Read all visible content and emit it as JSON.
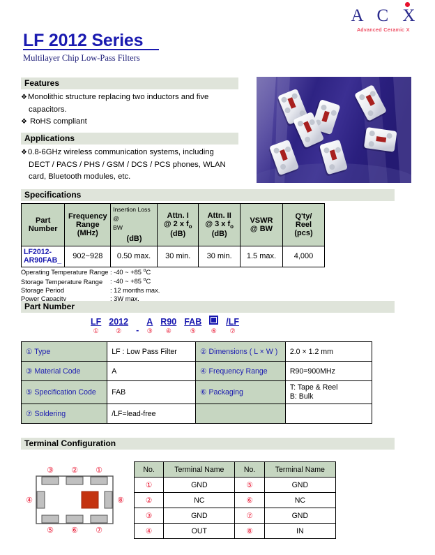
{
  "logo": {
    "letters": "A C X",
    "tagline": "Advanced Ceramic X",
    "dot_color": "#e8112d",
    "letter_color": "#2a2a8c"
  },
  "header": {
    "title": "LF 2012 Series",
    "subtitle": "Multilayer Chip Low-Pass Filters",
    "title_color": "#1a1ab0"
  },
  "features": {
    "heading": "Features",
    "items": [
      {
        "line1": "Monolithic structure replacing two inductors and five",
        "line2": "capacitors."
      },
      {
        "line1": " RoHS compliant",
        "line2": ""
      }
    ]
  },
  "applications": {
    "heading": "Applications",
    "items": [
      {
        "line1": "0.8-6GHz wireless communication systems, including",
        "line2": "DECT / PACS / PHS / GSM / DCS / PCS phones, WLAN",
        "line3": "card, Bluetooth modules, etc."
      }
    ]
  },
  "specifications": {
    "heading": "Specifications",
    "columns": [
      "Part Number",
      "Frequency Range (MHz)",
      "Insertion Loss @ BW (dB)",
      "Attn. I @ 2 x fo (dB)",
      "Attn. II @ 3 x fo (dB)",
      "VSWR @ BW",
      "Q'ty/ Reel (pcs)"
    ],
    "col_freq_l1": "Frequency",
    "col_freq_l2": "Range",
    "col_freq_l3": "(MHz)",
    "col_il_l1": "Insertion Loss @",
    "col_il_l2": "BW",
    "col_il_l3": "(dB)",
    "col_attn1_l1": "Attn. I",
    "col_attn1_l2": "@ 2 x f",
    "col_attn1_sub": "o",
    "col_attn1_l3": "(dB)",
    "col_attn2_l1": "Attn. II",
    "col_attn2_l2": "@ 3 x f",
    "col_attn2_sub": "o",
    "col_attn2_l3": "(dB)",
    "col_vswr_l1": "VSWR",
    "col_vswr_l2": "@ BW",
    "col_qty_l1": "Q'ty/",
    "col_qty_l2": "Reel",
    "col_qty_l3": "(pcs)",
    "col_partnumber": "Part Number",
    "rows": [
      {
        "part_number_l1": "LF2012-",
        "part_number_l2": "AR90FAB_",
        "frequency_range": "902~928",
        "insertion_loss": "0.50 max.",
        "attn_1": "30 min.",
        "attn_2": "30 min.",
        "vswr": "1.5 max.",
        "qty_reel": "4,000"
      }
    ]
  },
  "conditions": [
    {
      "label": "Operating Temperature Range",
      "value": ": -40 ~ +85 ",
      "unit": "o",
      "unit2": "C"
    },
    {
      "label": "Storage Temperature Range",
      "value": ": -40 ~ +85 ",
      "unit": "o",
      "unit2": "C"
    },
    {
      "label": "Storage Period",
      "value": ": 12 months max.",
      "unit": "",
      "unit2": ""
    },
    {
      "label": "Power Capacity",
      "value": ": 3W max.",
      "unit": "",
      "unit2": ""
    }
  ],
  "part_number": {
    "heading": "Part Number",
    "segments": [
      {
        "token": "LF",
        "circle": "①"
      },
      {
        "token": "2012",
        "circle": "②"
      },
      {
        "token": "-",
        "circle": ""
      },
      {
        "token": "A",
        "circle": "③"
      },
      {
        "token": "R90",
        "circle": "④"
      },
      {
        "token": "FAB",
        "circle": "⑤"
      },
      {
        "token": "■",
        "circle": "⑥"
      },
      {
        "token": "/LF",
        "circle": "⑦"
      }
    ],
    "definitions": [
      {
        "key1": "① Type",
        "val1": "LF : Low Pass Filter",
        "key2": "② Dimensions ( L × W )",
        "val2": "2.0 × 1.2 mm"
      },
      {
        "key1": "③ Material Code",
        "val1": "A",
        "key2": "④ Frequency Range",
        "val2": "R90=900MHz"
      },
      {
        "key1": "⑤ Specification Code",
        "val1": "FAB",
        "key2": "⑥ Packaging",
        "val2": "T: Tape & Reel\nB: Bulk"
      },
      {
        "key1": "⑦ Soldering",
        "val1": "/LF=lead-free",
        "key2": "",
        "val2": ""
      }
    ]
  },
  "terminal_configuration": {
    "heading": "Terminal Configuration",
    "diagram_labels": [
      "①",
      "②",
      "③",
      "④",
      "⑤",
      "⑥",
      "⑦",
      "⑧"
    ],
    "columns": [
      "No.",
      "Terminal Name",
      "No.",
      "Terminal Name"
    ],
    "rows": [
      {
        "no1": "①",
        "name1": "GND",
        "no2": "⑤",
        "name2": "GND"
      },
      {
        "no1": "②",
        "name1": "NC",
        "no2": "⑥",
        "name2": "NC"
      },
      {
        "no1": "③",
        "name1": "GND",
        "no2": "⑦",
        "name2": "GND"
      },
      {
        "no1": "④",
        "name1": "OUT",
        "no2": "⑧",
        "name2": "IN"
      }
    ]
  },
  "colors": {
    "section_bar": "#dfe4da",
    "table_header": "#c6d6c1",
    "accent_red": "#e8112d",
    "accent_blue": "#1a1ab0"
  }
}
